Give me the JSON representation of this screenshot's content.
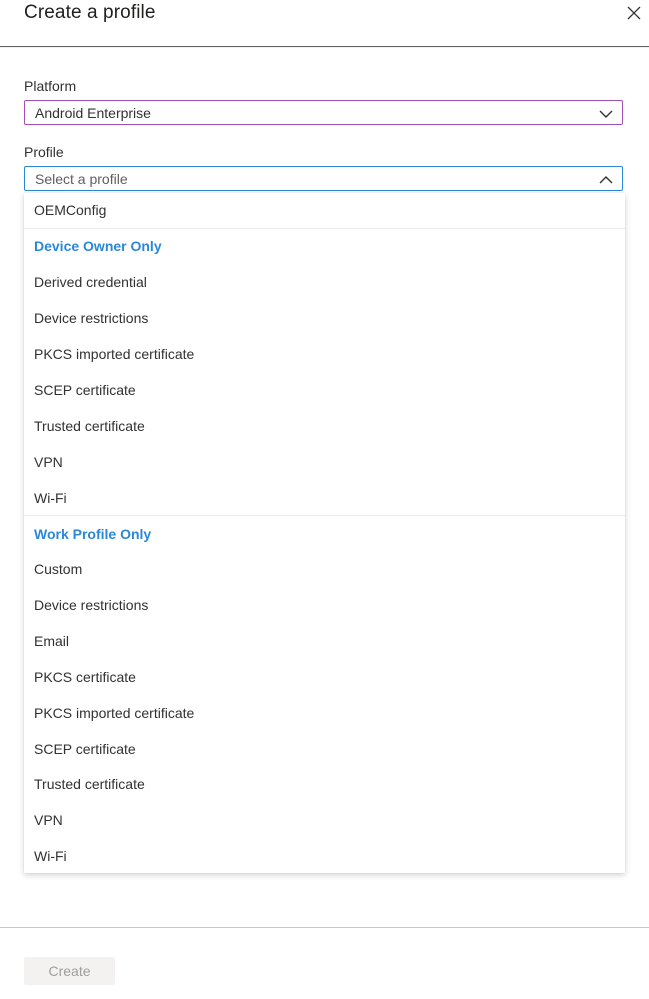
{
  "header": {
    "title": "Create a profile",
    "close_icon": "close-icon"
  },
  "platform": {
    "label": "Platform",
    "value": "Android Enterprise",
    "border_color": "#a34fb6"
  },
  "profile": {
    "label": "Profile",
    "placeholder": "Select a profile",
    "border_color": "#2b88d8",
    "expanded": true
  },
  "dropdown": {
    "top_item": "OEMConfig",
    "groups": [
      {
        "heading": "Device Owner Only",
        "items": [
          "Derived credential",
          "Device restrictions",
          "PKCS imported certificate",
          "SCEP certificate",
          "Trusted certificate",
          "VPN",
          "Wi-Fi"
        ]
      },
      {
        "heading": "Work Profile Only",
        "items": [
          "Custom",
          "Device restrictions",
          "Email",
          "PKCS certificate",
          "PKCS imported certificate",
          "SCEP certificate",
          "Trusted certificate",
          "VPN",
          "Wi-Fi"
        ]
      }
    ],
    "heading_color": "#2b88d8"
  },
  "footer": {
    "create_label": "Create",
    "create_enabled": false
  }
}
